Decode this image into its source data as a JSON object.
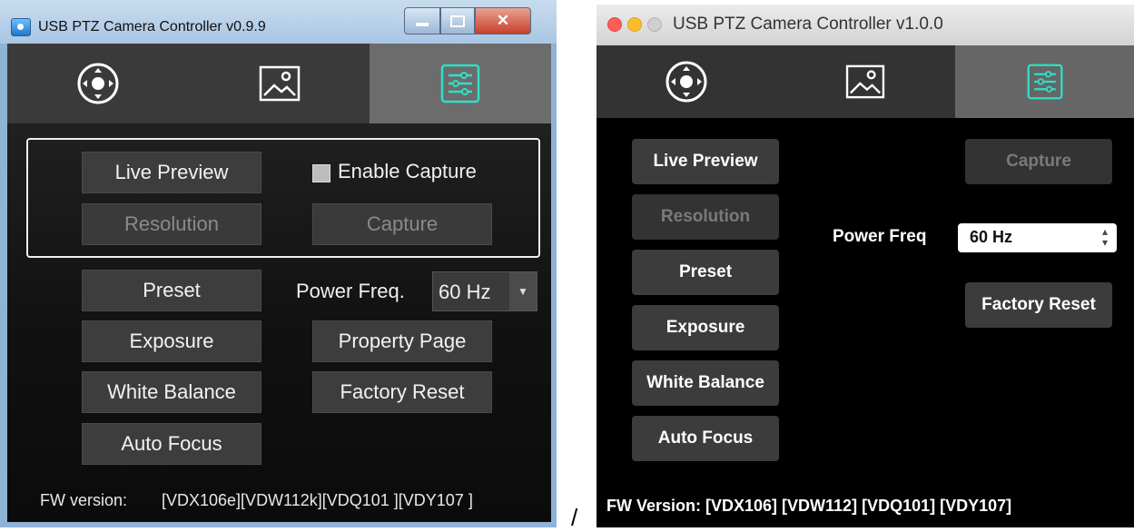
{
  "separator": "/",
  "windows_app": {
    "title": "USB PTZ Camera Controller v0.9.9",
    "tabs": [
      {
        "icon": "joystick-icon",
        "active": false
      },
      {
        "icon": "image-icon",
        "active": false
      },
      {
        "icon": "settings-sliders-icon",
        "active": true
      }
    ],
    "buttons": {
      "live_preview": "Live Preview",
      "resolution": "Resolution",
      "capture": "Capture",
      "preset": "Preset",
      "exposure": "Exposure",
      "white_balance": "White Balance",
      "auto_focus": "Auto Focus",
      "property_page": "Property Page",
      "factory_reset": "Factory Reset"
    },
    "enable_capture": {
      "label": "Enable Capture",
      "checked": false
    },
    "power_freq": {
      "label": "Power Freq.",
      "value": "60 Hz"
    },
    "fw_label": "FW version:",
    "fw_value": "[VDX106e][VDW112k][VDQ101 ][VDY107 ]",
    "accent_color": "#2ee0c8"
  },
  "mac_app": {
    "title": "USB PTZ Camera Controller v1.0.0",
    "tabs": [
      {
        "icon": "joystick-icon",
        "active": false
      },
      {
        "icon": "image-icon",
        "active": false
      },
      {
        "icon": "settings-sliders-icon",
        "active": true
      }
    ],
    "buttons": {
      "live_preview": "Live Preview",
      "resolution": "Resolution",
      "preset": "Preset",
      "exposure": "Exposure",
      "white_balance": "White Balance",
      "auto_focus": "Auto Focus",
      "capture": "Capture",
      "factory_reset": "Factory Reset"
    },
    "power_freq": {
      "label": "Power Freq",
      "value": "60 Hz"
    },
    "fw_text": "FW Version: [VDX106]  [VDW112] [VDQ101] [VDY107]",
    "accent_color": "#2ee0c8"
  }
}
